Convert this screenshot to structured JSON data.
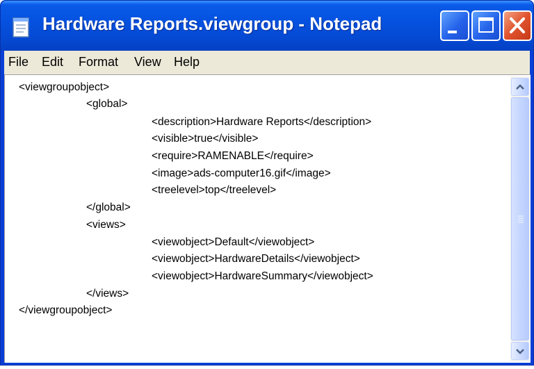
{
  "window": {
    "title": "Hardware Reports.viewgroup - Notepad",
    "colors": {
      "titlebar": "#0552e0",
      "close": "#e0532e",
      "menubar": "#ece9d8"
    }
  },
  "menu": {
    "items": [
      "File",
      "Edit",
      "Format",
      "View",
      "Help"
    ]
  },
  "editor": {
    "lines": [
      "<viewgroupobject>",
      "<global>",
      "<description>Hardware Reports</description>",
      "<visible>true</visible>",
      "<require>RAMENABLE</require>",
      "<image>ads-computer16.gif</image>",
      "<treelevel>top</treelevel>",
      "</global>",
      "<views>",
      "<viewobject>Default</viewobject>",
      "<viewobject>HardwareDetails</viewobject>",
      "<viewobject>HardwareSummary</viewobject>",
      "</views>",
      "</viewgroupobject>"
    ]
  },
  "icons": {
    "app": "notepad-icon",
    "minimize": "minimize-icon",
    "maximize": "maximize-icon",
    "close": "close-icon",
    "scroll_up": "chevron-up-icon",
    "scroll_down": "chevron-down-icon"
  }
}
